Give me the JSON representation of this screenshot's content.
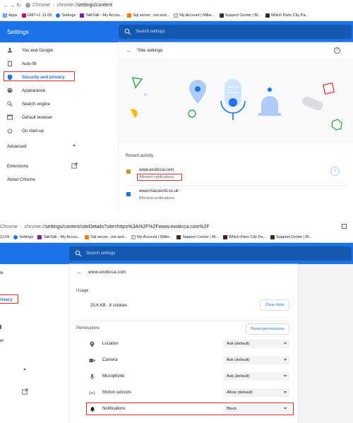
{
  "shot1": {
    "url": {
      "chrome_label": "Chrome",
      "separator": "|",
      "scheme": "chrome://",
      "path": "settings/content"
    },
    "bookmarks": [
      {
        "label": "Apps",
        "color": "#4285f4"
      },
      {
        "label": "GMT+1: 11:09",
        "color": "#c2185b"
      },
      {
        "label": "Settings",
        "color": "#1a73e8"
      },
      {
        "label": "TalkTalk - My Accou...",
        "color": "#7b1fa2"
      },
      {
        "label": "Sql server, .net and...",
        "color": "#f57c00"
      },
      {
        "label": "My Account | Miller...",
        "color": "#3c4043"
      },
      {
        "label": "Support Center | Bl...",
        "color": "#3e2723"
      },
      {
        "label": "Which Paris City Pa...",
        "color": "#3e2723"
      }
    ],
    "header_title": "Settings",
    "search_placeholder": "Search settings",
    "sidebar": [
      {
        "label": "You and Google",
        "icon": "person-icon"
      },
      {
        "label": "Auto-fill",
        "icon": "clipboard-icon"
      },
      {
        "label": "Security and privacy",
        "icon": "shield-icon"
      },
      {
        "label": "Appearance",
        "icon": "palette-icon"
      },
      {
        "label": "Search engine",
        "icon": "search-icon"
      },
      {
        "label": "Default browser",
        "icon": "browser-icon"
      },
      {
        "label": "On start-up",
        "icon": "power-icon"
      }
    ],
    "advanced_label": "Advanced",
    "extensions_label": "Extensions",
    "about_label": "About Chrome",
    "panel_title": "Site settings",
    "recent_activity_label": "Recent activity",
    "recent_items": [
      {
        "site": "www.exoticca.com",
        "detail": "Allowed notifications"
      },
      {
        "site": "www.macworld.co.uk",
        "detail": "Blocked notifications"
      }
    ]
  },
  "shot2": {
    "url": {
      "chrome_label": "Chrome",
      "separator": "|",
      "scheme": "chrome://",
      "path": "settings/content/siteDetails?site=https%3A%2F%2Fwww.exoticca.com%2F"
    },
    "bookmarks": [
      {
        "label": "11:09",
        "color": "#c2185b"
      },
      {
        "label": "Settings",
        "color": "#1a73e8"
      },
      {
        "label": "TalkTalk - My Accou...",
        "color": "#7b1fa2"
      },
      {
        "label": "Sql server, .net and...",
        "color": "#f57c00"
      },
      {
        "label": "My Account | Miller...",
        "color": "#3c4043"
      },
      {
        "label": "Support Center | Bl...",
        "color": "#3e2723"
      },
      {
        "label": "Which Paris City Pa...",
        "color": "#3e2723"
      },
      {
        "label": "Support Center | Bl...",
        "color": "#3e2723"
      }
    ],
    "search_placeholder": "Search settings",
    "sidebar_fragments": [
      "le",
      "rivacy",
      "er"
    ],
    "site_title": "www.exoticca.com",
    "usage_label": "Usage",
    "usage_value": "20.6 KB · 8 cookies",
    "clear_data_label": "Clear data",
    "permissions_label": "Permissions",
    "reset_permissions_label": "Reset permissions",
    "permissions": [
      {
        "label": "Location",
        "value": "Ask (default)",
        "icon": "location-icon"
      },
      {
        "label": "Camera",
        "value": "Ask (default)",
        "icon": "camera-icon"
      },
      {
        "label": "Microphone",
        "value": "Ask (default)",
        "icon": "microphone-icon"
      },
      {
        "label": "Motion sensors",
        "value": "Allow (default)",
        "icon": "motion-sensor-icon"
      },
      {
        "label": "Notifications",
        "value": "Block",
        "icon": "bell-icon"
      }
    ]
  },
  "colors": {
    "accent": "#1a73e8",
    "highlight": "#d93025"
  }
}
